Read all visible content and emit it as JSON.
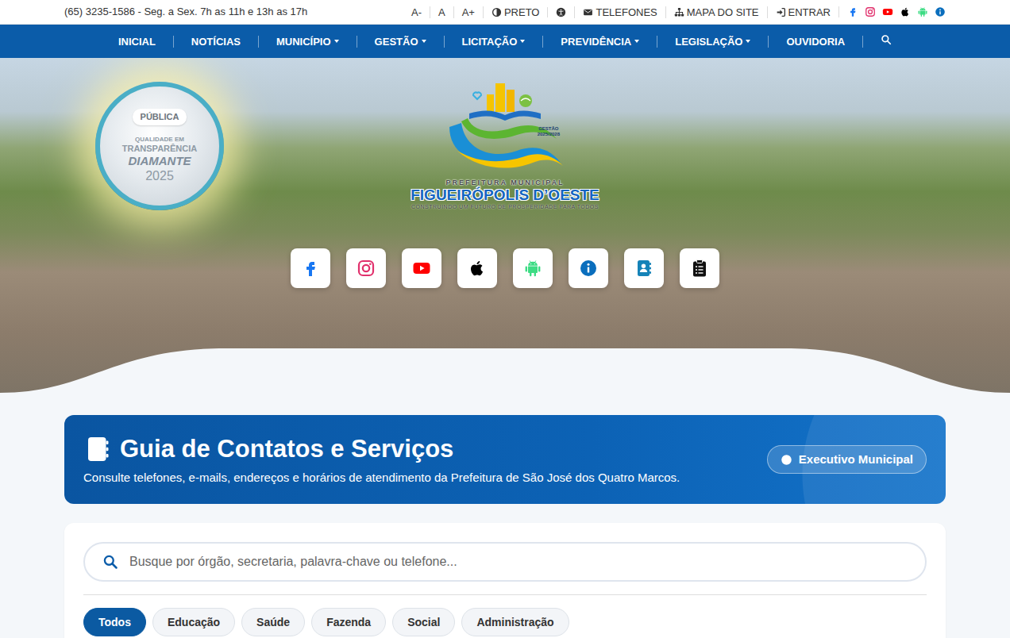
{
  "topbar": {
    "hours": "(65) 3235-1586 - Seg. a Sex. 7h as 11h e 13h as 17h",
    "font_sizes": [
      "A-",
      "A",
      "A+"
    ],
    "links": [
      {
        "kind": "contrast",
        "label": "PRETO"
      },
      {
        "kind": "accessibility"
      },
      {
        "kind": "phones",
        "label": "TELEFONES"
      },
      {
        "kind": "sitemap",
        "label": "MAPA DO SITE"
      },
      {
        "kind": "login",
        "label": "ENTRAR"
      }
    ],
    "social": [
      {
        "kind": "facebook",
        "color": "#1877f2"
      },
      {
        "kind": "instagram",
        "color": "#e1306c"
      },
      {
        "kind": "youtube",
        "color": "#ff0000"
      },
      {
        "kind": "apple",
        "color": "#000000"
      },
      {
        "kind": "android",
        "color": "#3ddc84"
      },
      {
        "kind": "info",
        "color": "#0a6ebd"
      }
    ]
  },
  "nav": {
    "items": [
      {
        "label": "INICIAL",
        "dropdown": false
      },
      {
        "label": "NOTÍCIAS",
        "dropdown": false
      },
      {
        "label": "MUNICÍPIO",
        "dropdown": true
      },
      {
        "label": "GESTÃO",
        "dropdown": true
      },
      {
        "label": "LICITAÇÃO",
        "dropdown": true
      },
      {
        "label": "PREVIDÊNCIA",
        "dropdown": true
      },
      {
        "label": "LEGISLAÇÃO",
        "dropdown": true
      },
      {
        "label": "OUVIDORIA",
        "dropdown": false
      }
    ]
  },
  "hero": {
    "seal": {
      "tag": "PÚBLICA",
      "lines": [
        "QUALIDADE EM",
        "TRANSPARÊNCIA",
        "DIAMANTE",
        "2025"
      ]
    },
    "logo": {
      "term_label": "GESTÃO",
      "term_years": "2025/2028",
      "top": "PREFEITURA MUNICIPAL",
      "name": "FIGUEIRÓPOLIS D’OESTE",
      "tagline": "CONSTRUINDO UM FUTURO DE PROSPERIDADE PARA TODOS"
    },
    "quick_links": [
      {
        "kind": "facebook",
        "color": "#1877f2"
      },
      {
        "kind": "instagram",
        "color": "#e1306c"
      },
      {
        "kind": "youtube",
        "color": "#ff0000"
      },
      {
        "kind": "apple",
        "color": "#000000"
      },
      {
        "kind": "android",
        "color": "#3ddc84"
      },
      {
        "kind": "info",
        "color": "#0a6ebd"
      },
      {
        "kind": "contacts",
        "color": "#1583b8"
      },
      {
        "kind": "services",
        "color": "#111111"
      }
    ]
  },
  "guide": {
    "title": "Guia de Contatos e Serviços",
    "subtitle": "Consulte telefones, e-mails, endereços e horários de atendimento da Prefeitura de São José dos Quatro Marcos.",
    "button": "Executivo Municipal"
  },
  "search": {
    "placeholder": "Busque por órgão, secretaria, palavra-chave ou telefone..."
  },
  "filters": [
    {
      "label": "Todos",
      "selected": true
    },
    {
      "label": "Educação",
      "selected": false
    },
    {
      "label": "Saúde",
      "selected": false
    },
    {
      "label": "Fazenda",
      "selected": false
    },
    {
      "label": "Social",
      "selected": false
    },
    {
      "label": "Administração",
      "selected": false
    }
  ]
}
